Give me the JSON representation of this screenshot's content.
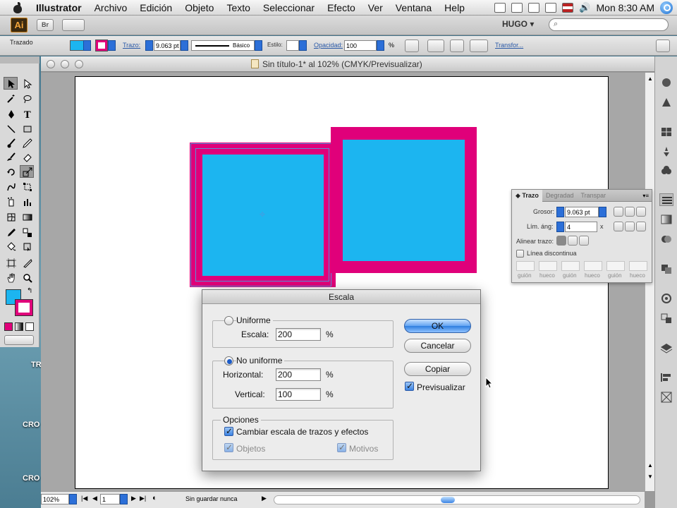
{
  "menubar": {
    "app": "Illustrator",
    "items": [
      "Archivo",
      "Edición",
      "Objeto",
      "Texto",
      "Seleccionar",
      "Efecto",
      "Ver",
      "Ventana",
      "Help"
    ],
    "clock": "Mon 8:30 AM"
  },
  "appbar": {
    "logo": "Ai",
    "bridge": "Br",
    "workspace": "HUGO ▾"
  },
  "control": {
    "selection_label": "Trazado",
    "stroke_label": "Trazo:",
    "stroke_value": "9.063 pt",
    "profile": "Básico",
    "style_label": "Estilo:",
    "opacity_label": "Opacidad:",
    "opacity_value": "100",
    "percent": "%",
    "transform_link": "Transfor..."
  },
  "document": {
    "title": "Sin título-1* al 102% (CMYK/Previsualizar)"
  },
  "status": {
    "zoom": "102%",
    "page": "1",
    "save_state": "Sin guardar nunca"
  },
  "desktop": {
    "labels": [
      "TR",
      "CRO",
      "CRO"
    ]
  },
  "trazo_panel": {
    "tabs": [
      "◆ Trazo",
      "Degradad",
      "Transpar"
    ],
    "weight_label": "Grosor:",
    "weight_value": "9.063 pt",
    "limit_label": "Lím. áng:",
    "limit_value": "4",
    "limit_unit": "x",
    "align_label": "Alinear trazo:",
    "dashed_label": "Línea discontinua",
    "dash_labels": [
      "guión",
      "hueco",
      "guión",
      "hueco",
      "guión",
      "hueco"
    ]
  },
  "dialog": {
    "title": "Escala",
    "uniform_label": "Uniforme",
    "scale_label": "Escala:",
    "scale_value": "200",
    "nonuniform_label": "No uniforme",
    "horizontal_label": "Horizontal:",
    "horizontal_value": "200",
    "vertical_label": "Vertical:",
    "vertical_value": "100",
    "percent": "%",
    "options_label": "Opciones",
    "scale_strokes_label": "Cambiar escala de trazos y efectos",
    "objects_label": "Objetos",
    "patterns_label": "Motivos",
    "ok": "OK",
    "cancel": "Cancelar",
    "copy": "Copiar",
    "preview_label": "Previsualizar",
    "uniform_selected": false,
    "nonuniform_selected": true
  },
  "colors": {
    "fill": "#1cb5f0",
    "stroke": "#e0007a",
    "accent": "#2f7fe0"
  }
}
